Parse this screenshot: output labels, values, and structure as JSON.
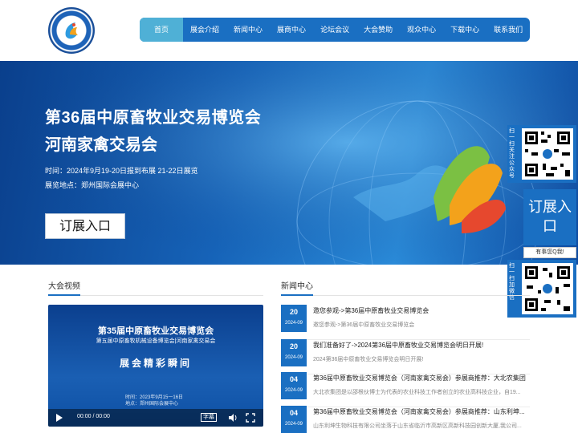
{
  "nav": {
    "items": [
      "首页",
      "展会介绍",
      "新闻中心",
      "展商中心",
      "论坛会议",
      "大会赞助",
      "观众中心",
      "下载中心",
      "联系我们"
    ]
  },
  "banner": {
    "title1": "第36届中原畜牧业交易博览会",
    "title2": "河南家禽交易会",
    "time": "时间：2024年9月19-20日报到布展   21-22日展览",
    "venue": "展览地点：郑州国际会展中心",
    "cta": "订展入口"
  },
  "sidebar": {
    "qr1_label": "扫一扫关注公众号",
    "book": "订展入口",
    "chat": "有事您Q我!",
    "qr2_label": "扫一扫加微信"
  },
  "video_section": {
    "title": "大会视频",
    "video_title": "第35届中原畜牧业交易博览会",
    "video_subtitle": "第五届中原畜牧机械设备博览会|河南家禽交易会",
    "video_caption": "展会精彩瞬间",
    "video_time": "时间：2023年9月15一16日",
    "video_venue": "地点：郑州国际会展中心",
    "player_time": "00:00 / 00:00",
    "cc_label": "字幕"
  },
  "news_section": {
    "title": "新闻中心",
    "items": [
      {
        "day": "20",
        "ym": "2024-09",
        "title": "邀您参观->第36届中原畜牧业交易博览会",
        "summary": "邀您参观->第36届中原畜牧业交易博览会"
      },
      {
        "day": "20",
        "ym": "2024-09",
        "title": "我们准备好了->2024第36届中原畜牧业交易博览会明日开展!",
        "summary": "2024第36届中原畜牧业交易博览会明日开展!"
      },
      {
        "day": "04",
        "ym": "2024-09",
        "title": "第36届中原畜牧业交易博览会（河南家禽交易会）参展商推荐：大北农集团",
        "summary": "大北农集团是以邵根伙博士为代表的农业科技工作者创立的农业高科技企业，自19..."
      },
      {
        "day": "04",
        "ym": "2024-09",
        "title": "第36届中原畜牧业交易博览会（河南家禽交易会）参展商推荐：山东利坤...",
        "summary": "山东利坤生物科技有限公司坐落于山东省临沂市高新区高新科技园创新大厦,我公司..."
      }
    ]
  },
  "colors": {
    "brand_blue": "#1a6fc2",
    "nav_active": "#4fb0d6"
  }
}
